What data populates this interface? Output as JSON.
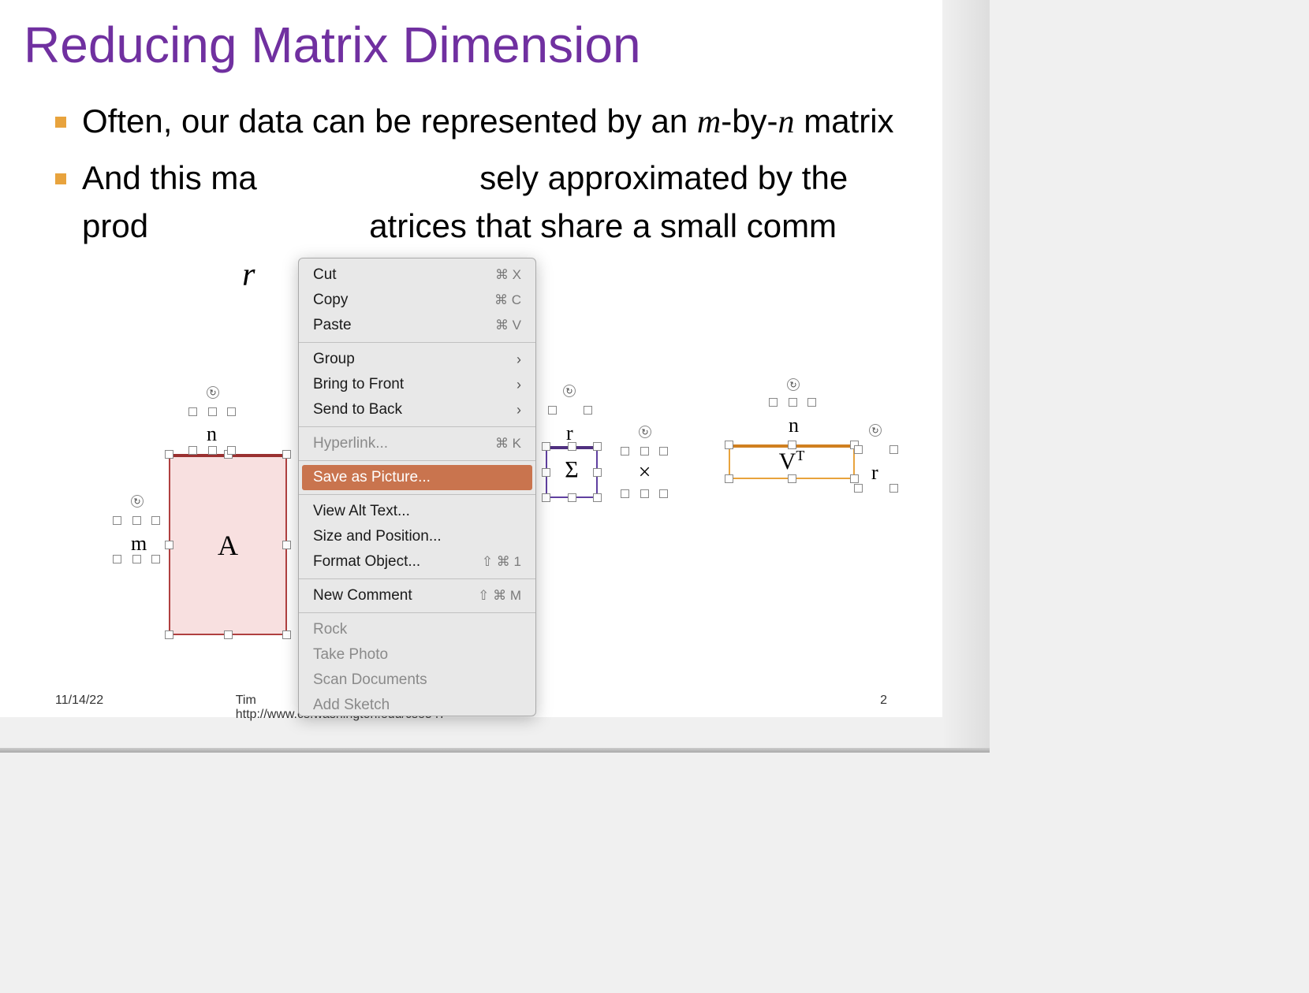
{
  "title": "Reducing  Matrix Dimension",
  "bullets": {
    "b1_pre": "Often, our data can be represented by an ",
    "b1_m": "m",
    "b1_mid": "-by-",
    "b1_n": "n",
    "b1_post": " matrix",
    "b2_pre": "And this ma",
    "b2_mid": "sely approximated by the prod",
    "b2_mid2": "atrices that share a small comm",
    "b2_r": "r"
  },
  "labels": {
    "A": "A",
    "sigma": "Σ",
    "x": "×",
    "V": "V",
    "VT_sup": "T",
    "dim_n_A": "n",
    "dim_m_A": "m",
    "dim_r_sigma": "r",
    "dim_n_V": "n",
    "dim_r_V": "r"
  },
  "footer": {
    "date": "11/14/22",
    "center_left": "Tim",
    "center_right": ", http://www.cs.washington.edu/cse547",
    "page": "2"
  },
  "menu": {
    "cut": "Cut",
    "cut_sc": "⌘ X",
    "copy": "Copy",
    "copy_sc": "⌘ C",
    "paste": "Paste",
    "paste_sc": "⌘ V",
    "group": "Group",
    "btf": "Bring to Front",
    "stb": "Send to Back",
    "hyperlink": "Hyperlink...",
    "hyperlink_sc": "⌘ K",
    "save_pic": "Save as Picture...",
    "alt_text": "View Alt Text...",
    "size_pos": "Size and Position...",
    "format_obj": "Format Object...",
    "format_sc": "⇧ ⌘  1",
    "new_comment": "New Comment",
    "comment_sc": "⇧ ⌘ M",
    "rock": "Rock",
    "take_photo": "Take Photo",
    "scan_docs": "Scan Documents",
    "add_sketch": "Add Sketch"
  }
}
